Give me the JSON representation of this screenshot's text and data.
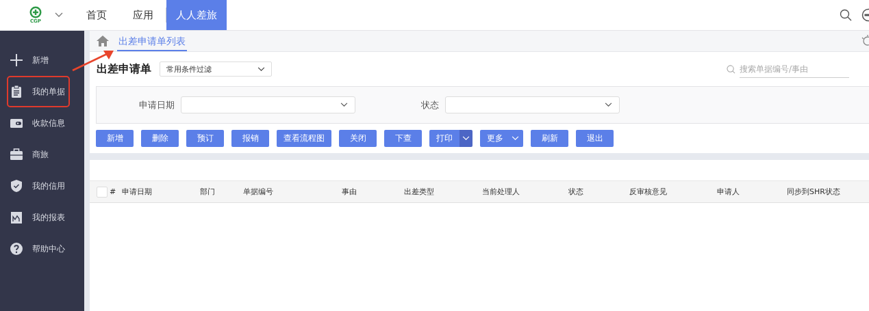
{
  "top_nav": {
    "logo_text": "CGP",
    "items": [
      {
        "label": "首页",
        "selected": false
      },
      {
        "label": "应用",
        "selected": false
      },
      {
        "label": "人人差旅",
        "selected": true
      }
    ]
  },
  "sidebar": {
    "items": [
      {
        "label": "新增",
        "annotated": false
      },
      {
        "label": "我的单据",
        "annotated": true
      },
      {
        "label": "收款信息",
        "annotated": false
      },
      {
        "label": "商旅",
        "annotated": false
      },
      {
        "label": "我的信用",
        "annotated": false
      },
      {
        "label": "我的报表",
        "annotated": false
      },
      {
        "label": "帮助中心",
        "annotated": false
      }
    ]
  },
  "breadcrumb": {
    "label": "出差申请单列表",
    "selected": true
  },
  "page": {
    "title": "出差申请单",
    "filter_select": "常用条件过滤",
    "search": {
      "placeholder": "搜索单据编号/事由"
    }
  },
  "filters": [
    {
      "label": "申请日期"
    },
    {
      "label": "状态"
    }
  ],
  "buttons": [
    {
      "label": "新增",
      "kind": "plain"
    },
    {
      "label": "删除",
      "kind": "plain"
    },
    {
      "label": "预订",
      "kind": "plain"
    },
    {
      "label": "报销",
      "kind": "plain"
    },
    {
      "label": "查看流程图",
      "kind": "plain"
    },
    {
      "label": "关闭",
      "kind": "plain"
    },
    {
      "label": "下查",
      "kind": "plain"
    },
    {
      "label": "打印",
      "kind": "split"
    },
    {
      "label": "更多",
      "kind": "dropdown"
    },
    {
      "label": "刷新",
      "kind": "plain"
    },
    {
      "label": "退出",
      "kind": "plain"
    }
  ],
  "table": {
    "select_all_checked": false,
    "columns": [
      "#",
      "申请日期",
      "部门",
      "单据编号",
      "事由",
      "出差类型",
      "当前处理人",
      "状态",
      "反审核意见",
      "申请人",
      "同步到SHR状态"
    ]
  }
}
